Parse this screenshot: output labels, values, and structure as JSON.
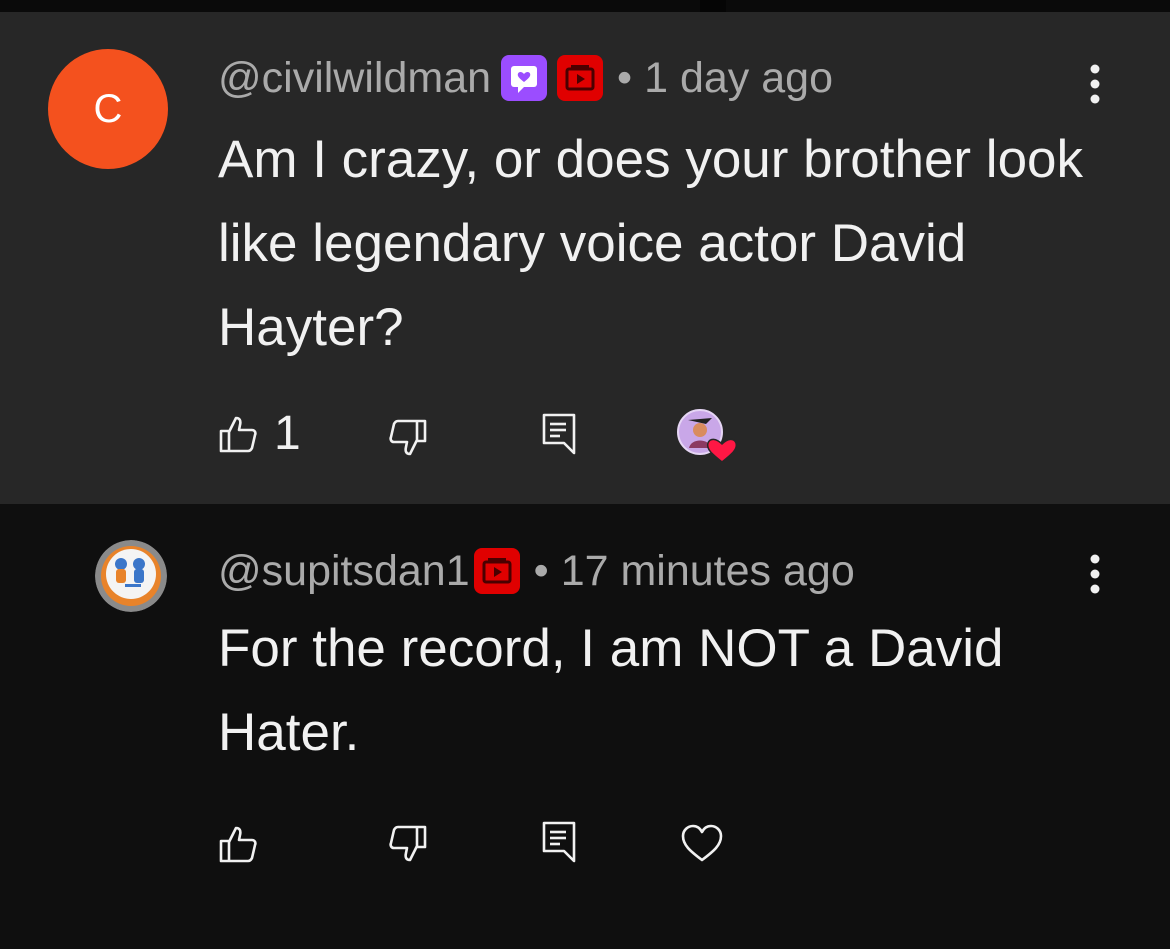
{
  "comments": [
    {
      "avatar_letter": "C",
      "avatar_color": "#f4511e",
      "author": "@civilwildman",
      "badges": [
        "member-badge-icon",
        "youtube-badge-icon"
      ],
      "separator": "•",
      "time": "1 day ago",
      "text": "Am I crazy, or does your brother look like legendary voice actor David Hayter?",
      "likes": "1",
      "hearted_by_creator": true
    },
    {
      "author": "@supitsdan1",
      "badges": [
        "youtube-badge-icon"
      ],
      "separator": "•",
      "time": "17 minutes ago",
      "text": "For the record, I am NOT a David Hater.",
      "likes": "",
      "hearted_by_creator": false
    }
  ],
  "colors": {
    "highlighted_bg": "#272727",
    "page_bg": "#0f0f0f",
    "member_badge": "#9b4dff",
    "youtube_badge": "#e00000",
    "heart": "#ff1744"
  }
}
